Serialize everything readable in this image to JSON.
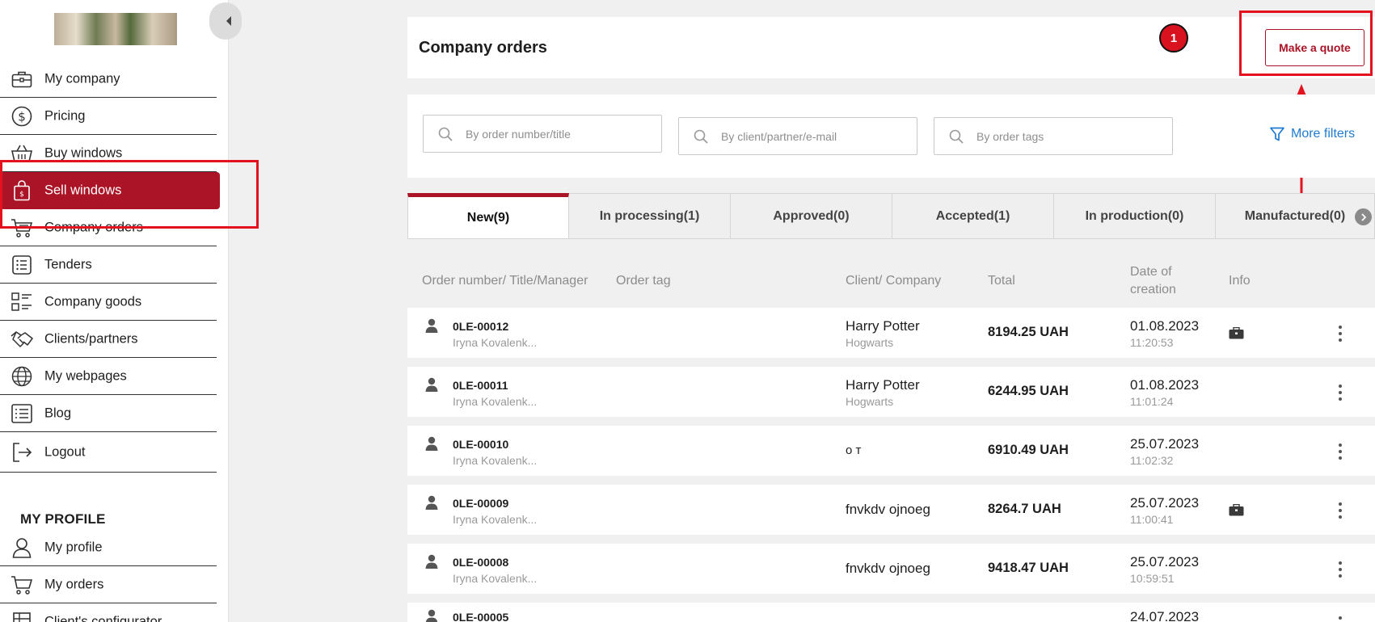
{
  "sidebar": {
    "collapse_icon": "chevron-left-icon",
    "items": [
      {
        "label": "My company",
        "icon": "briefcase-icon"
      },
      {
        "label": "Pricing",
        "icon": "dollar-icon"
      },
      {
        "label": "Buy windows",
        "icon": "basket-icon"
      },
      {
        "label": "Sell windows",
        "icon": "shopping-bag-icon",
        "active": true
      },
      {
        "label": "Company orders",
        "icon": "cart-icon"
      },
      {
        "label": "Tenders",
        "icon": "list-icon"
      },
      {
        "label": "Company goods",
        "icon": "goods-icon"
      },
      {
        "label": "Clients/partners",
        "icon": "handshake-icon"
      },
      {
        "label": "My webpages",
        "icon": "globe-icon"
      },
      {
        "label": "Blog",
        "icon": "blog-icon"
      },
      {
        "label": "Logout",
        "icon": "logout-icon"
      }
    ],
    "profile_title": "MY PROFILE",
    "profile_items": [
      {
        "label": "My profile",
        "icon": "user-icon"
      },
      {
        "label": "My orders",
        "icon": "cart-icon"
      },
      {
        "label": "Client's configurator",
        "icon": "configurator-icon"
      }
    ]
  },
  "header": {
    "title": "Company orders",
    "badge": "1",
    "make_quote": "Make a quote"
  },
  "filters": {
    "order_placeholder": "By order number/title",
    "client_placeholder": "By client/partner/e-mail",
    "tags_placeholder": "By order tags",
    "more_filters": "More filters"
  },
  "tabs": [
    {
      "label": "New(9)",
      "active": true
    },
    {
      "label": "In processing(1)"
    },
    {
      "label": "Approved(0)"
    },
    {
      "label": "Accepted(1)"
    },
    {
      "label": "In production(0)"
    },
    {
      "label": "Manufactured(0)"
    }
  ],
  "columns": {
    "order": "Order number/ Title/Manager",
    "tag": "Order tag",
    "client": "Client/ Company",
    "total": "Total",
    "date_line1": "Date of",
    "date_line2": "creation",
    "info": "Info"
  },
  "orders": [
    {
      "number": "0LE-00012",
      "manager": "Iryna Kovalenk...",
      "client": "Harry Potter",
      "company": "Hogwarts",
      "total": "8194.25 UAH",
      "date": "01.08.2023",
      "time": "11:20:53",
      "has_info": true
    },
    {
      "number": "0LE-00011",
      "manager": "Iryna Kovalenk...",
      "client": "Harry Potter",
      "company": "Hogwarts",
      "total": "6244.95 UAH",
      "date": "01.08.2023",
      "time": "11:01:24",
      "has_info": false
    },
    {
      "number": "0LE-00010",
      "manager": "Iryna Kovalenk...",
      "client": "о т",
      "company": "",
      "total": "6910.49 UAH",
      "date": "25.07.2023",
      "time": "11:02:32",
      "has_info": false
    },
    {
      "number": "0LE-00009",
      "manager": "Iryna Kovalenk...",
      "client": "fnvkdv ojnoeg",
      "company": "",
      "total": "8264.7 UAH",
      "date": "25.07.2023",
      "time": "11:00:41",
      "has_info": true
    },
    {
      "number": "0LE-00008",
      "manager": "Iryna Kovalenk...",
      "client": "fnvkdv ojnoeg",
      "company": "",
      "total": "9418.47 UAH",
      "date": "25.07.2023",
      "time": "10:59:51",
      "has_info": false
    },
    {
      "number": "0LE-00005",
      "manager": "",
      "client": "",
      "company": "",
      "total": "",
      "date": "24.07.2023",
      "time": "",
      "has_info": false
    }
  ],
  "colors": {
    "accent": "#ab1426",
    "highlight": "#e4121f",
    "link": "#1f7bd1"
  }
}
